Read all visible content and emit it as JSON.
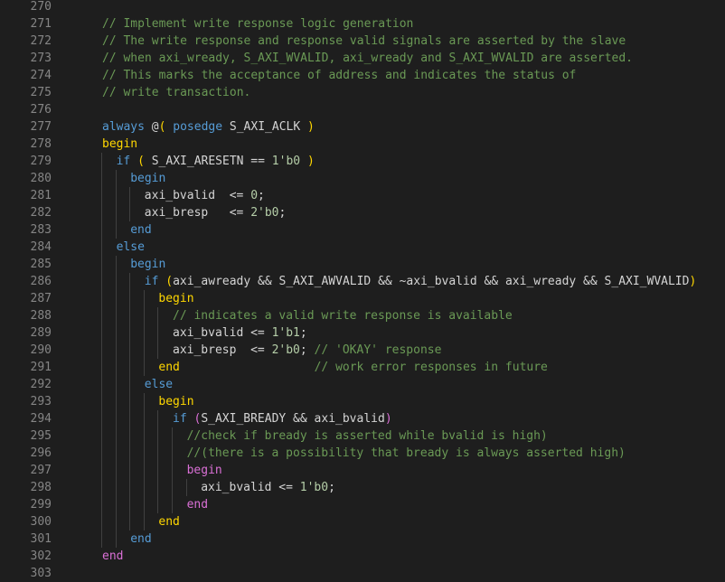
{
  "editor": {
    "lines": [
      {
        "n": "270",
        "indent": 0,
        "tokens": []
      },
      {
        "n": "271",
        "indent": 2,
        "tokens": [
          {
            "t": "// Implement write response logic generation",
            "c": "cm"
          }
        ]
      },
      {
        "n": "272",
        "indent": 2,
        "tokens": [
          {
            "t": "// The write response and response valid signals are asserted by the slave",
            "c": "cm"
          }
        ]
      },
      {
        "n": "273",
        "indent": 2,
        "tokens": [
          {
            "t": "// when axi_wready, S_AXI_WVALID, axi_wready and S_AXI_WVALID are asserted.",
            "c": "cm"
          }
        ]
      },
      {
        "n": "274",
        "indent": 2,
        "tokens": [
          {
            "t": "// This marks the acceptance of address and indicates the status of",
            "c": "cm"
          }
        ]
      },
      {
        "n": "275",
        "indent": 2,
        "tokens": [
          {
            "t": "// write transaction.",
            "c": "cm"
          }
        ]
      },
      {
        "n": "276",
        "indent": 0,
        "tokens": []
      },
      {
        "n": "277",
        "indent": 2,
        "tokens": [
          {
            "t": "always",
            "c": "kw"
          },
          {
            "t": " @",
            "c": "id"
          },
          {
            "t": "(",
            "c": "p1"
          },
          {
            "t": " ",
            "c": "id"
          },
          {
            "t": "posedge",
            "c": "kw"
          },
          {
            "t": " S_AXI_ACLK ",
            "c": "id"
          },
          {
            "t": ")",
            "c": "p1"
          }
        ]
      },
      {
        "n": "278",
        "indent": 2,
        "tokens": [
          {
            "t": "begin",
            "c": "p1"
          }
        ]
      },
      {
        "n": "279",
        "indent": 3,
        "tokens": [
          {
            "t": "if",
            "c": "kw"
          },
          {
            "t": " ",
            "c": "id"
          },
          {
            "t": "(",
            "c": "p1"
          },
          {
            "t": " S_AXI_ARESETN == ",
            "c": "id"
          },
          {
            "t": "1'b0",
            "c": "num"
          },
          {
            "t": " ",
            "c": "id"
          },
          {
            "t": ")",
            "c": "p1"
          }
        ]
      },
      {
        "n": "280",
        "indent": 4,
        "tokens": [
          {
            "t": "begin",
            "c": "kw"
          }
        ]
      },
      {
        "n": "281",
        "indent": 5,
        "tokens": [
          {
            "t": "axi_bvalid  <= ",
            "c": "id"
          },
          {
            "t": "0",
            "c": "num"
          },
          {
            "t": ";",
            "c": "id"
          }
        ]
      },
      {
        "n": "282",
        "indent": 5,
        "tokens": [
          {
            "t": "axi_bresp   <= ",
            "c": "id"
          },
          {
            "t": "2'b0",
            "c": "num"
          },
          {
            "t": ";",
            "c": "id"
          }
        ]
      },
      {
        "n": "283",
        "indent": 4,
        "tokens": [
          {
            "t": "end",
            "c": "kw"
          }
        ]
      },
      {
        "n": "284",
        "indent": 3,
        "tokens": [
          {
            "t": "else",
            "c": "kw"
          }
        ]
      },
      {
        "n": "285",
        "indent": 4,
        "tokens": [
          {
            "t": "begin",
            "c": "kw"
          }
        ]
      },
      {
        "n": "286",
        "indent": 5,
        "tokens": [
          {
            "t": "if",
            "c": "kw"
          },
          {
            "t": " ",
            "c": "id"
          },
          {
            "t": "(",
            "c": "p1"
          },
          {
            "t": "axi_awready && S_AXI_AWVALID && ~axi_bvalid && axi_wready && S_AXI_WVALID",
            "c": "id"
          },
          {
            "t": ")",
            "c": "p1"
          }
        ]
      },
      {
        "n": "287",
        "indent": 6,
        "tokens": [
          {
            "t": "begin",
            "c": "p1"
          }
        ]
      },
      {
        "n": "288",
        "indent": 7,
        "tokens": [
          {
            "t": "// indicates a valid write response is available",
            "c": "cm"
          }
        ]
      },
      {
        "n": "289",
        "indent": 7,
        "tokens": [
          {
            "t": "axi_bvalid <= ",
            "c": "id"
          },
          {
            "t": "1'b1",
            "c": "num"
          },
          {
            "t": ";",
            "c": "id"
          }
        ]
      },
      {
        "n": "290",
        "indent": 7,
        "tokens": [
          {
            "t": "axi_bresp  <= ",
            "c": "id"
          },
          {
            "t": "2'b0",
            "c": "num"
          },
          {
            "t": "; ",
            "c": "id"
          },
          {
            "t": "// 'OKAY' response",
            "c": "cm"
          }
        ]
      },
      {
        "n": "291",
        "indent": 6,
        "tokens": [
          {
            "t": "end",
            "c": "p1"
          },
          {
            "t": "                   ",
            "c": "id"
          },
          {
            "t": "// work error responses in future",
            "c": "cm"
          }
        ]
      },
      {
        "n": "292",
        "indent": 5,
        "tokens": [
          {
            "t": "else",
            "c": "kw"
          }
        ]
      },
      {
        "n": "293",
        "indent": 6,
        "tokens": [
          {
            "t": "begin",
            "c": "p1"
          }
        ]
      },
      {
        "n": "294",
        "indent": 7,
        "tokens": [
          {
            "t": "if",
            "c": "kw"
          },
          {
            "t": " ",
            "c": "id"
          },
          {
            "t": "(",
            "c": "p2"
          },
          {
            "t": "S_AXI_BREADY && axi_bvalid",
            "c": "id"
          },
          {
            "t": ")",
            "c": "p2"
          }
        ]
      },
      {
        "n": "295",
        "indent": 8,
        "tokens": [
          {
            "t": "//check if bready is asserted while bvalid is high)",
            "c": "cm"
          }
        ]
      },
      {
        "n": "296",
        "indent": 8,
        "tokens": [
          {
            "t": "//(there is a possibility that bready is always asserted high)",
            "c": "cm"
          }
        ]
      },
      {
        "n": "297",
        "indent": 8,
        "tokens": [
          {
            "t": "begin",
            "c": "p2"
          }
        ]
      },
      {
        "n": "298",
        "indent": 9,
        "tokens": [
          {
            "t": "axi_bvalid <= ",
            "c": "id"
          },
          {
            "t": "1'b0",
            "c": "num"
          },
          {
            "t": ";",
            "c": "id"
          }
        ]
      },
      {
        "n": "299",
        "indent": 8,
        "tokens": [
          {
            "t": "end",
            "c": "p2"
          }
        ]
      },
      {
        "n": "300",
        "indent": 6,
        "tokens": [
          {
            "t": "end",
            "c": "p1"
          }
        ]
      },
      {
        "n": "301",
        "indent": 4,
        "tokens": [
          {
            "t": "end",
            "c": "kw"
          }
        ]
      },
      {
        "n": "302",
        "indent": 2,
        "tokens": [
          {
            "t": "end",
            "c": "p2"
          }
        ]
      },
      {
        "n": "303",
        "indent": 0,
        "tokens": []
      }
    ]
  }
}
